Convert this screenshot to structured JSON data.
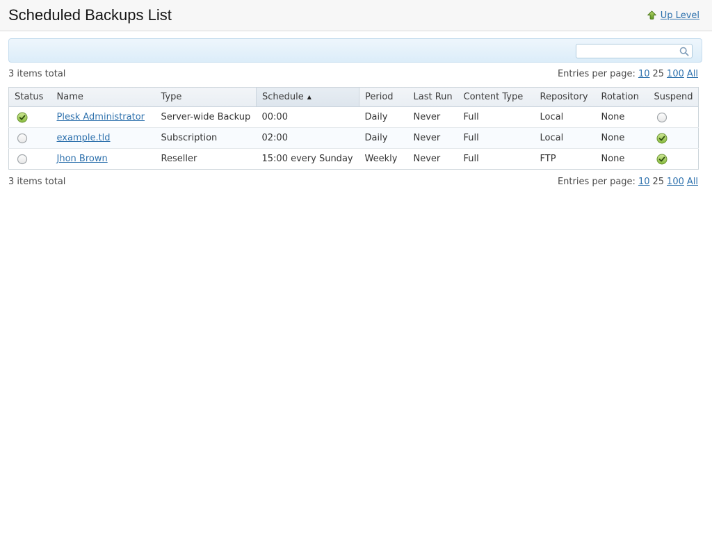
{
  "page": {
    "title": "Scheduled Backups List",
    "up_level_label": "Up Level"
  },
  "toolbar": {
    "search_value": "",
    "search_placeholder": ""
  },
  "pagination": {
    "items_total": "3 items total",
    "entries_per_page_label": "Entries per page:",
    "options": [
      {
        "label": "10",
        "link": true
      },
      {
        "label": "25",
        "link": false
      },
      {
        "label": "100",
        "link": true
      },
      {
        "label": "All",
        "link": true
      }
    ]
  },
  "table": {
    "columns": [
      "Status",
      "Name",
      "Type",
      "Schedule",
      "Period",
      "Last Run",
      "Content Type",
      "Repository",
      "Rotation",
      "Suspend"
    ],
    "sorted_column": "Schedule",
    "sort_direction": "ascending",
    "sort_asc_icon": "▲",
    "rows": [
      {
        "status": "active",
        "name": "Plesk Administrator",
        "type": "Server-wide Backup",
        "schedule": "00:00",
        "period": "Daily",
        "last_run": "Never",
        "content_type": "Full",
        "repository": "Local",
        "rotation": "None",
        "suspended": false
      },
      {
        "status": "inactive",
        "name": "example.tld",
        "type": "Subscription",
        "schedule": "02:00",
        "period": "Daily",
        "last_run": "Never",
        "content_type": "Full",
        "repository": "Local",
        "rotation": "None",
        "suspended": true
      },
      {
        "status": "inactive",
        "name": "Jhon Brown",
        "type": "Reseller",
        "schedule": "15:00 every Sunday",
        "period": "Weekly",
        "last_run": "Never",
        "content_type": "Full",
        "repository": "FTP",
        "rotation": "None",
        "suspended": true
      }
    ]
  },
  "colors": {
    "link_blue": "#2e71ad",
    "status_green": "#8bbb40",
    "toolbar_blue": "#dcedf9"
  }
}
